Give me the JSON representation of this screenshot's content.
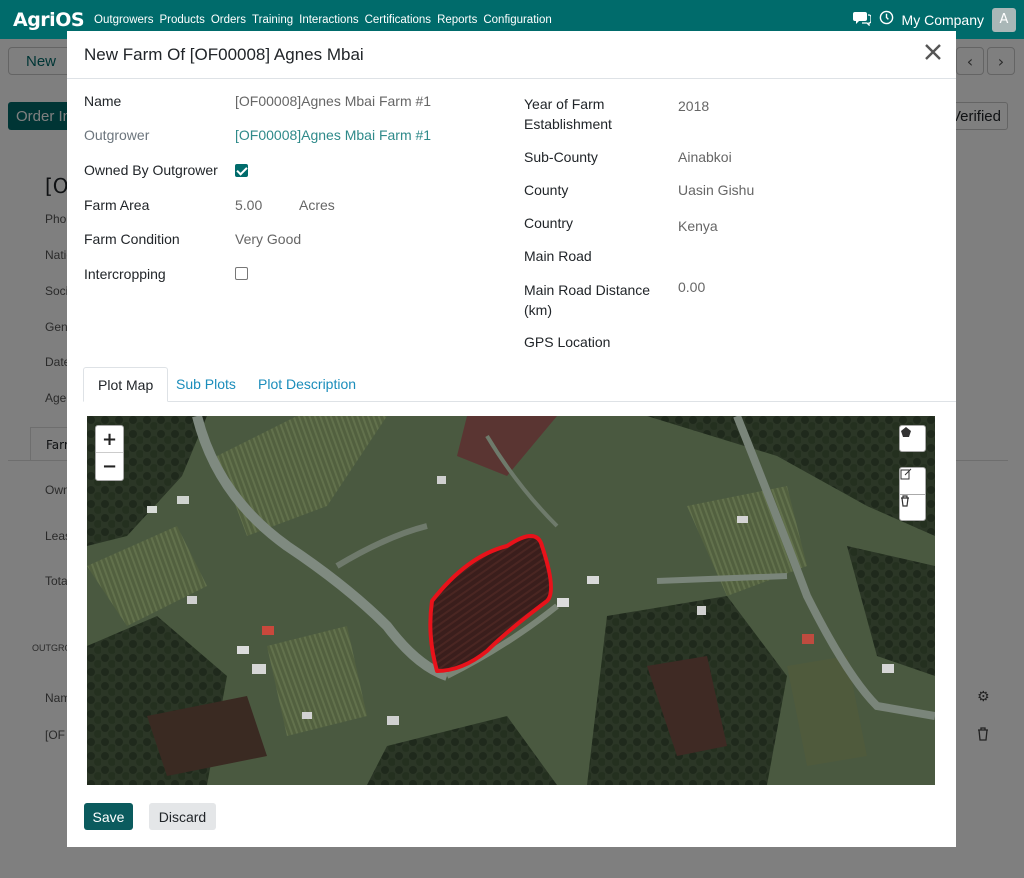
{
  "navbar": {
    "logo": "AgriOS",
    "menu": [
      "Outgrowers",
      "Products",
      "Orders",
      "Training",
      "Interactions",
      "Certifications",
      "Reports",
      "Configuration"
    ],
    "company": "My Company",
    "avatar_letter": "A",
    "icons": [
      "chat-icon",
      "clock-icon"
    ]
  },
  "background": {
    "new_button": "New",
    "order_button": "Order Info",
    "verified_button": "Verified",
    "record_title": "[OF",
    "side_labels": [
      "Phone",
      "National ID",
      "Social",
      "Gender",
      "Date",
      "Age"
    ],
    "tab_label": "Farms",
    "list_labels": [
      "Owned",
      "Leased",
      "Total"
    ],
    "section_label": "OUTGROWER",
    "row_labels": [
      "Name",
      "[OF"
    ]
  },
  "modal": {
    "title": "New Farm Of [OF00008] Agnes Mbai",
    "left_fields": {
      "name_label": "Name",
      "name_value": "[OF00008]Agnes Mbai Farm #1",
      "outgrower_label": "Outgrower",
      "outgrower_value": "[OF00008]Agnes Mbai Farm #1",
      "owned_label": "Owned By Outgrower",
      "owned_checked": true,
      "farm_area_label": "Farm Area",
      "farm_area_value": "5.00",
      "farm_area_unit": "Acres",
      "condition_label": "Farm Condition",
      "condition_value": "Very Good",
      "intercropping_label": "Intercropping",
      "intercropping_checked": false
    },
    "right_fields": {
      "year_label_1": "Year of Farm",
      "year_label_2": "Establishment",
      "year_value": "2018",
      "subcounty_label": "Sub-County",
      "subcounty_value": "Ainabkoi",
      "county_label": "County",
      "county_value": "Uasin Gishu",
      "country_label": "Country",
      "country_value": "Kenya",
      "main_road_label": "Main Road",
      "distance_label_1": "Main Road Distance",
      "distance_label_2": "(km)",
      "distance_value": "0.00",
      "gps_label": "GPS Location"
    },
    "tabs": [
      "Plot Map",
      "Sub Plots",
      "Plot Description"
    ],
    "active_tab": "Plot Map",
    "map": {
      "zoom_in": "+",
      "zoom_out": "−",
      "polygon_color": "#e8121a"
    },
    "footer": {
      "save": "Save",
      "discard": "Discard"
    }
  }
}
